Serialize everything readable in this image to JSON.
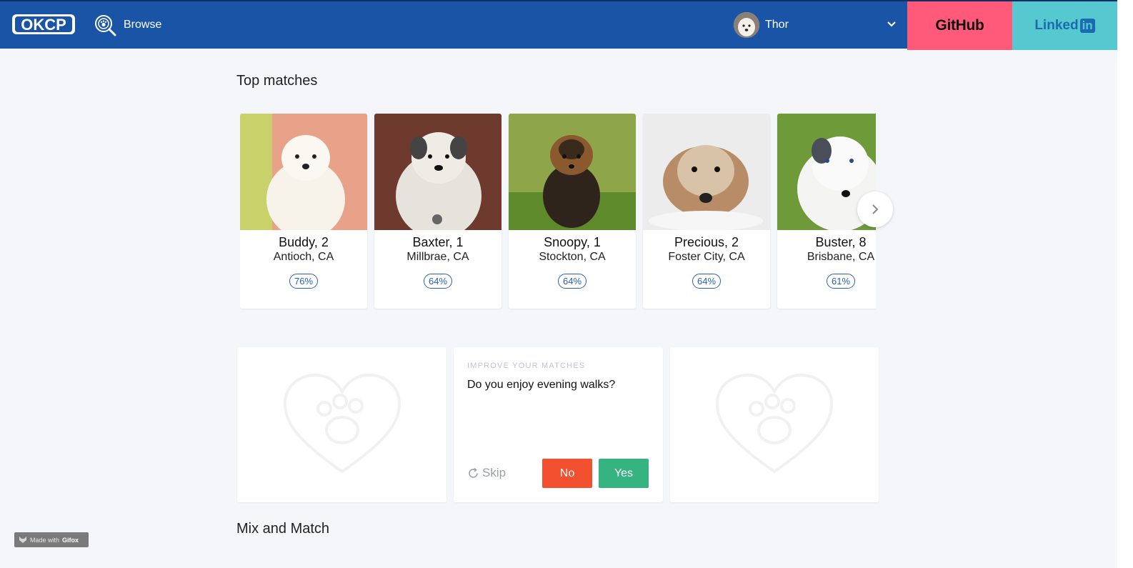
{
  "header": {
    "logo_text": "OKCP",
    "browse_label": "Browse",
    "user_name": "Thor",
    "github_label": "GitHub",
    "linkedin_label_a": "Linked",
    "linkedin_label_b": "in",
    "colors": {
      "bar": "#1a54a6",
      "github": "#ff5a79",
      "linkedin": "#56c8d0"
    }
  },
  "top_matches": {
    "title": "Top matches",
    "cards": [
      {
        "name": "Buddy, 2",
        "location": "Antioch, CA",
        "match": "76%"
      },
      {
        "name": "Baxter, 1",
        "location": "Millbrae, CA",
        "match": "64%"
      },
      {
        "name": "Snoopy, 1",
        "location": "Stockton, CA",
        "match": "64%"
      },
      {
        "name": "Precious, 2",
        "location": "Foster City, CA",
        "match": "64%"
      },
      {
        "name": "Buster, 8",
        "location": "Brisbane, CA",
        "match": "61%"
      }
    ]
  },
  "improve": {
    "eyebrow": "IMPROVE YOUR MATCHES",
    "question": "Do you enjoy evening walks?",
    "skip_label": "Skip",
    "no_label": "No",
    "yes_label": "Yes",
    "colors": {
      "no": "#f3502f",
      "yes": "#35b381"
    }
  },
  "mix": {
    "title": "Mix and Match"
  },
  "watermark": {
    "prefix": "Made with",
    "brand": "Gifox"
  }
}
